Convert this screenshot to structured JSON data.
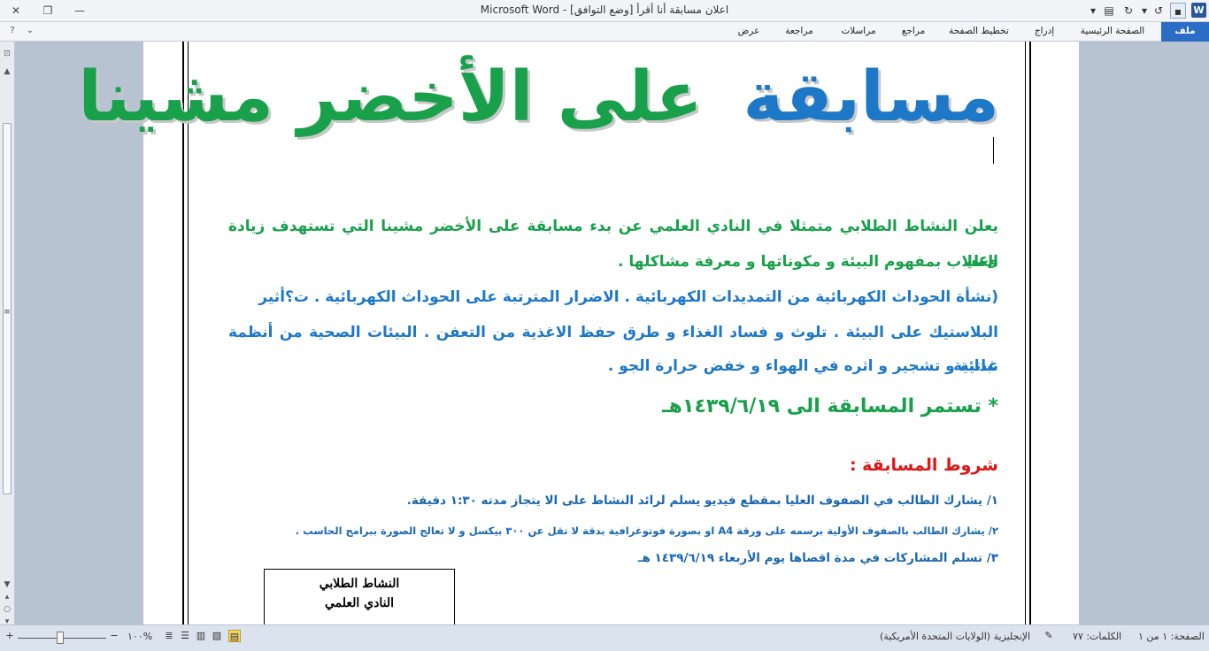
{
  "window": {
    "title": "اعلان مسابقة أنا أقرأ [وضع التوافق] - Microsoft Word",
    "minimize_icon": "minimize-icon",
    "restore_icon": "restore-icon",
    "close_icon": "close-icon"
  },
  "quick_access": {
    "app_logo": "W",
    "save": "save-icon",
    "undo": "undo-icon",
    "redo": "redo-icon",
    "print_preview": "print-preview-icon",
    "customize": "customize-qat-icon"
  },
  "ribbon": {
    "tabs": [
      {
        "label": "ملف"
      },
      {
        "label": "الصفحة الرئيسية"
      },
      {
        "label": "إدراج"
      },
      {
        "label": "تخطيط الصفحة"
      },
      {
        "label": "مراجع"
      },
      {
        "label": "مراسلات"
      },
      {
        "label": "مراجعة"
      },
      {
        "label": "عرض"
      }
    ],
    "help_icon": "help-icon",
    "minimize_ribbon_icon": "chevron-down-icon"
  },
  "document": {
    "headline_blue": "مسابقة",
    "headline_green": "على الأخضر مشينا",
    "intro_line1": "يعلن النشاط الطلابي متمثلا في النادي العلمي عن بدء مسابقة على الأخضر مشينا التي تستهدف زيادة وعي",
    "intro_line2": "الطلاب بمفهوم البيئة و مكوناتها و معرفة مشاكلها .",
    "topics_line1": "(نشأة الحوداث الكهربائية من التمديدات الكهربائية . الاضرار المترتبة على الحوداث الكهربائية . ت؟أثير",
    "topics_line2": "البلاستيك على البيئة . تلوث و فساد الغذاء و طرق حفظ الاغذية من التعفن . البيئات الصحية من أنظمة غذائية",
    "topics_line3": "نباتية و تشجير و اثره في الهواء و خفض حرارة الجو .",
    "deadline": "* تستمر المسابقة الى ١٤٣٩/٦/١٩هـ",
    "conditions_title": "شروط المسابقة :",
    "condition1": "١/ يشارك الطالب في الصفوف العليا بمقطع فيديو يسلم لرائد النشاط على الا يتجاز مدته ١:٣٠ دقيقة.",
    "condition2": "٢/ يشارك الطالب بالصفوف الأولية برسمه على ورقة  A4 او بصورة فوتوغرافية بدقة لا تقل عن ٣٠٠ بيكسل و لا تعالج الصورة ببرامج الحاسب .",
    "condition3": "٣/ تسلم المشاركات في مدة اقصاها يوم الأربعاء ١٤٣٩/٦/١٩ هـ",
    "sign_line1": "النشاط الطلابي",
    "sign_line2": "النادي العلمي"
  },
  "statusbar": {
    "page": "الصفحة: ١ من ١",
    "words": "الكلمات: ٧٧",
    "language": "الإنجليزية (الولايات المتحدة الأمريكية)",
    "zoom": "١٠٠%",
    "zoom_minus": "−",
    "zoom_plus": "+"
  }
}
